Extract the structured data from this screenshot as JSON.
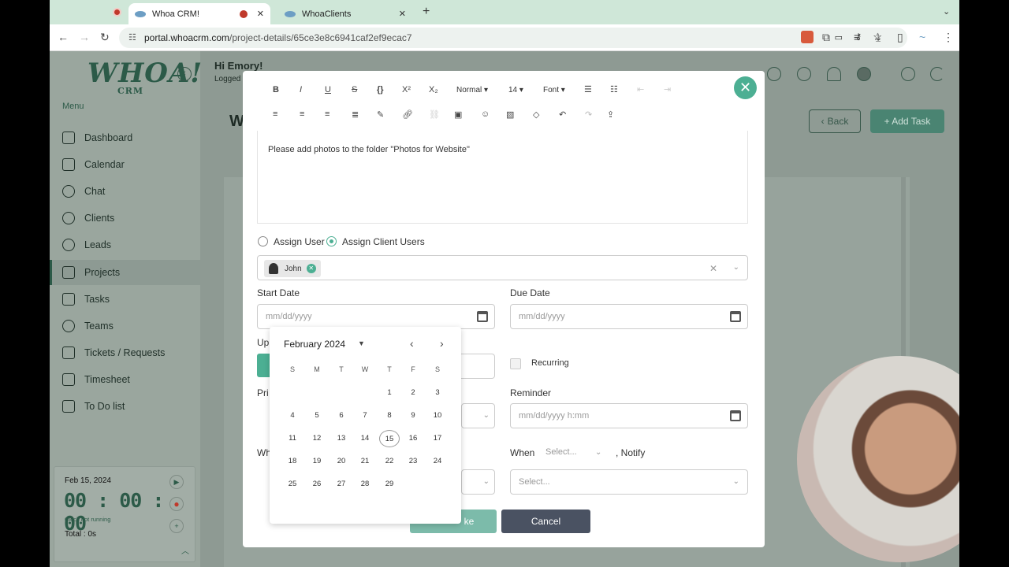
{
  "browser": {
    "tabs": [
      {
        "title": "Whoa CRM!"
      },
      {
        "title": "WhoaClients"
      }
    ],
    "url_host": "portal.whoacrm.com",
    "url_path": "/project-details/65ce3e8c6941caf2ef9ecac7"
  },
  "sidebar": {
    "logo": "WHOA!",
    "logo_sub": "CRM",
    "menu_label": "Menu",
    "items": [
      {
        "label": "Dashboard"
      },
      {
        "label": "Calendar"
      },
      {
        "label": "Chat"
      },
      {
        "label": "Clients"
      },
      {
        "label": "Leads"
      },
      {
        "label": "Projects"
      },
      {
        "label": "Tasks"
      },
      {
        "label": "Teams"
      },
      {
        "label": "Tickets / Requests"
      },
      {
        "label": "Timesheet"
      },
      {
        "label": "To Do list"
      }
    ],
    "timer": {
      "date": "Feb 15, 2024",
      "clock": "00 : 00 : 00",
      "status": "Clock not running",
      "total": "Total : 0s"
    }
  },
  "header": {
    "greeting": "Hi Emory!",
    "sub": "Logged",
    "page_initial": "W",
    "back_label": "Back",
    "add_task_label": "+ Add Task"
  },
  "modal": {
    "toolbar": {
      "format": "Normal",
      "size": "14",
      "font": "Font"
    },
    "editor_text": "Please add photos to the folder \"Photos for Website\"",
    "assign_user": "Assign User",
    "assign_client_users": "Assign Client Users",
    "selected_user": "John",
    "start_date_label": "Start Date",
    "start_date_placeholder": "mm/dd/yyyy",
    "due_date_label": "Due Date",
    "due_date_placeholder": "mm/dd/yyyy",
    "upload_label": "Up",
    "recurring_label": "Recurring",
    "priority_label": "Pri",
    "reminder_label": "Reminder",
    "reminder_placeholder": "mm/dd/yyyy h:mm",
    "who_label": "Wh",
    "when_label": "When",
    "when_placeholder": "Select...",
    "notify_label": ", Notify",
    "notify_placeholder": "Select...",
    "save_label": "ke",
    "cancel_label": "Cancel"
  },
  "datepicker": {
    "month_label": "February 2024",
    "weekdays": [
      "S",
      "M",
      "T",
      "W",
      "T",
      "F",
      "S"
    ],
    "weeks": [
      [
        "",
        "",
        "",
        "",
        "1",
        "2",
        "3"
      ],
      [
        "4",
        "5",
        "6",
        "7",
        "8",
        "9",
        "10"
      ],
      [
        "11",
        "12",
        "13",
        "14",
        "15",
        "16",
        "17"
      ],
      [
        "18",
        "19",
        "20",
        "21",
        "22",
        "23",
        "24"
      ],
      [
        "25",
        "26",
        "27",
        "28",
        "29",
        "",
        ""
      ]
    ],
    "selected_day": "15"
  },
  "colors": {
    "accent": "#4caf93",
    "brand": "#2c5a48"
  }
}
